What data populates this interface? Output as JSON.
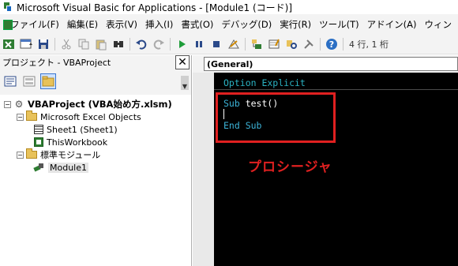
{
  "window": {
    "title": "Microsoft Visual Basic for Applications - [Module1 (コード)]"
  },
  "menubar": {
    "items": [
      {
        "label": "ファイル(F)"
      },
      {
        "label": "編集(E)"
      },
      {
        "label": "表示(V)"
      },
      {
        "label": "挿入(I)"
      },
      {
        "label": "書式(O)"
      },
      {
        "label": "デバッグ(D)"
      },
      {
        "label": "実行(R)"
      },
      {
        "label": "ツール(T)"
      },
      {
        "label": "アドイン(A)"
      },
      {
        "label": "ウィン"
      }
    ]
  },
  "toolbar": {
    "position_status": "4 行, 1 桁"
  },
  "project_pane": {
    "title": "プロジェクト - VBAProject",
    "close_glyph": "✕",
    "tree": {
      "project": "VBAProject (VBA始め方.xlsm)",
      "excel_objects_folder": "Microsoft Excel Objects",
      "sheet1": "Sheet1 (Sheet1)",
      "thisworkbook": "ThisWorkbook",
      "modules_folder": "標準モジュール",
      "module1": "Module1"
    }
  },
  "code_window": {
    "object_combo": "(General)",
    "option_line": "Option Explicit",
    "sub_keyword": "Sub",
    "sub_name": " test()",
    "end_line": "End Sub",
    "annotation": "プロシージャ"
  },
  "colors": {
    "keyword": "#3cb4d8",
    "annotation": "#e02020",
    "code_background": "#000000"
  }
}
